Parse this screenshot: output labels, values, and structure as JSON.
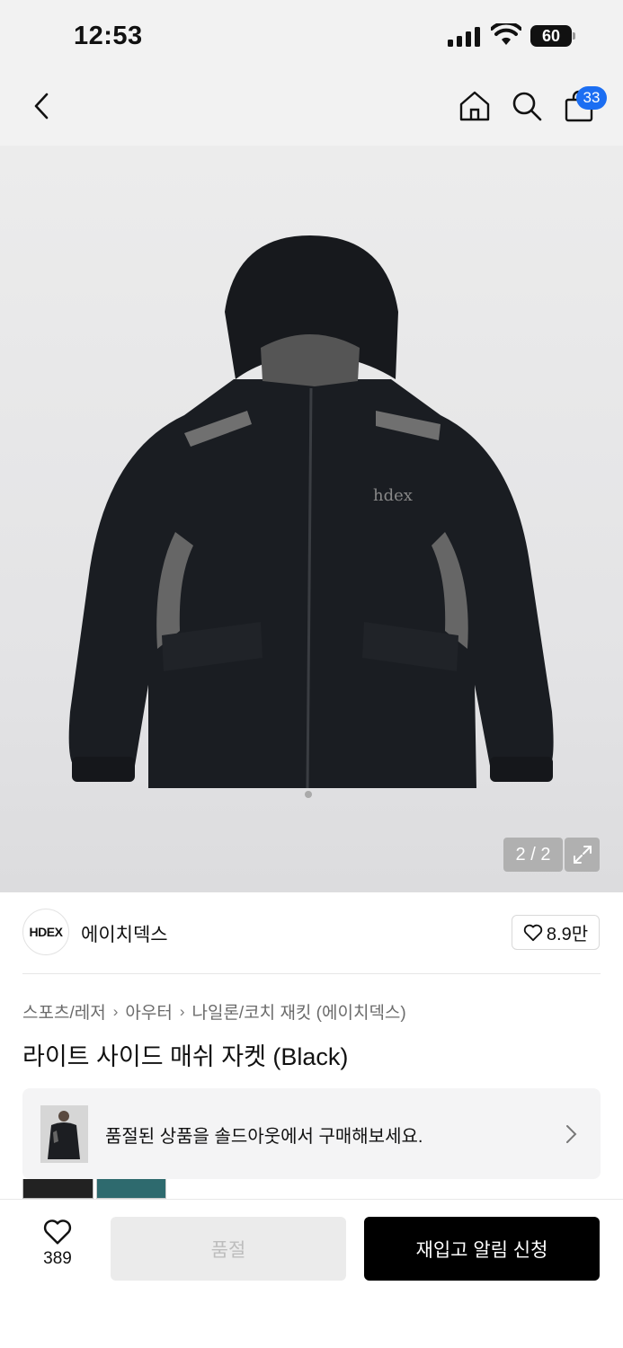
{
  "status_bar": {
    "time": "12:53",
    "battery": "60",
    "icons": [
      "signal-icon",
      "wifi-icon",
      "battery-icon"
    ]
  },
  "nav": {
    "icons": [
      "chevron-left-icon",
      "home-icon",
      "search-icon",
      "bag-icon"
    ],
    "cart_count": "33"
  },
  "gallery": {
    "counter": "2 / 2",
    "expand_icon": "expand-icon",
    "chest_logo": "hdex"
  },
  "brand": {
    "logo_text": "HDEX",
    "name": "에이치덱스",
    "like_count": "8.9만",
    "like_icon": "heart-outline-icon"
  },
  "breadcrumb": [
    "스포츠/레저",
    "아우터",
    "나일론/코치 재킷 (에이치덱스)"
  ],
  "product": {
    "title": "라이트 사이드 매쉬 자켓 (Black)"
  },
  "soldout_banner": {
    "text": "품절된 상품을 솔드아웃에서 구매해보세요."
  },
  "bottom_bar": {
    "like_count": "389",
    "soldout_label": "품절",
    "restock_label": "재입고 알림 신청"
  },
  "colors": {
    "accent": "#1c6ef2",
    "jacket": "#1a1d22",
    "mesh": "#6a6a6a",
    "primary_button": "#000000"
  }
}
